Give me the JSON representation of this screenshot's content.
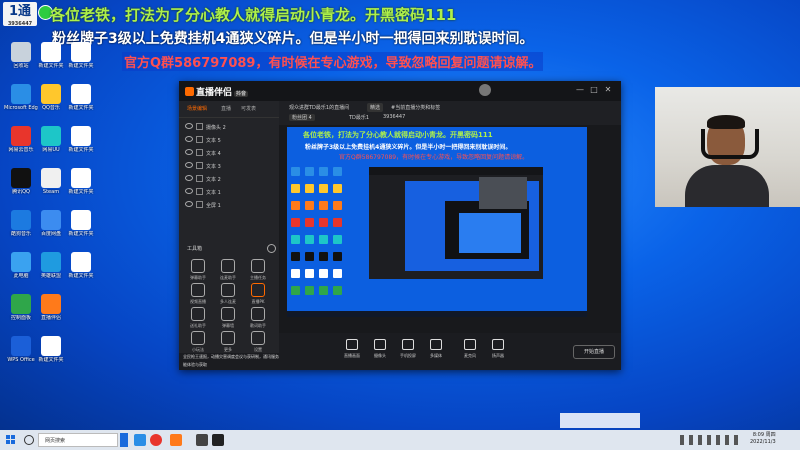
{
  "banner": {
    "line1": "各位老铁，打法为了分心教人就得启动小青龙。开黑密码111",
    "line2": "粉丝牌子3级以上免费挂机4通狭义碎片。但是半小时一把得回来别耽误时间。",
    "line3": "官方Q群586797089，有时候在专心游戏，导致忽略回复问题请谅解。",
    "logo_text": "1通",
    "logo_sub": "3936447"
  },
  "desktop_icons": [
    {
      "label": "回收站",
      "color": "#c8d2dc"
    },
    {
      "label": "Microsoft Edge",
      "color": "#2a8ee6"
    },
    {
      "label": "网易云音乐",
      "color": "#e8352c"
    },
    {
      "label": "腾讯QQ",
      "color": "#111111"
    },
    {
      "label": "酷狗音乐",
      "color": "#1c7ae0"
    },
    {
      "label": "此电脑",
      "color": "#3aa2f0"
    },
    {
      "label": "控制面板",
      "color": "#2fa64a"
    },
    {
      "label": "WPS Office",
      "color": "#1b5fd8"
    },
    {
      "label": "新建文件夹",
      "color": "#ffffff"
    },
    {
      "label": "QQ音乐",
      "color": "#ffc72c"
    },
    {
      "label": "网易UU",
      "color": "#1dc6c8"
    },
    {
      "label": "Steam",
      "color": "#f0f0f0"
    },
    {
      "label": "百度网盘",
      "color": "#3c8cf0"
    },
    {
      "label": "英雄联盟",
      "color": "#1f9be0"
    },
    {
      "label": "直播伴侣",
      "color": "#ff7a1a"
    },
    {
      "label": "新建文件夹",
      "color": "#ffffff"
    },
    {
      "label": "新建文件夹",
      "color": "#ffffff"
    },
    {
      "label": "新建文件夹",
      "color": "#ffffff"
    },
    {
      "label": "新建文件夹",
      "color": "#ffffff"
    },
    {
      "label": "新建文件夹",
      "color": "#ffffff"
    },
    {
      "label": "新建文件夹",
      "color": "#ffffff"
    },
    {
      "label": "新建文件夹",
      "color": "#ffffff"
    }
  ],
  "app": {
    "title": "直播伴侣",
    "version": "抖音",
    "tabs": [
      "场景编辑",
      "直播",
      "可发表"
    ],
    "scenes": [
      "摄像头 2",
      "文本 5",
      "文本 4",
      "文本 3",
      "文本 2",
      "文本 1",
      "全屏 1"
    ],
    "toolbox_title": "工具箱",
    "tools": [
      "弹幕助手",
      "连麦助手",
      "主播任务",
      "视频直播",
      "多人连麦",
      "直播PK",
      "送礼助手",
      "弹幕墙",
      "歌词助手",
      "小玩法",
      "更多",
      "设置"
    ],
    "footer_text": "全民枪王速报，动播灾害调度会议与获研制，通讯服务功能体验与获取",
    "header_title": "观众进群TD最乐1的直播间",
    "header_tag": "精选",
    "header_sub": "#当前直播分类和标签",
    "header_fans": "粉丝团 4",
    "header_user": "TD最乐1",
    "header_id": "3936447",
    "bottom_tools": [
      "直播画面",
      "摄像头",
      "手机投屏",
      "多媒体",
      "麦克风",
      "扬声器"
    ],
    "live_button": "开始直播"
  },
  "preview": {
    "line1": "各位老铁，打法为了分心教人就得启动小青龙。开黑密码111",
    "line2": "粉丝牌子3级以上免费挂机4通狭义碎片。但是半小时一把得回来别耽误时间。",
    "line3": "官方Q群586797089，有时候在专心游戏，导致忽略回复问题请谅解。"
  },
  "taskbar": {
    "search_placeholder": "网页搜索",
    "clock_time": "8:09 周四",
    "clock_date": "2022/11/3"
  },
  "colors": {
    "banner_green": "#aef04a",
    "banner_red": "#ff5050",
    "accent": "#ff6a00"
  }
}
